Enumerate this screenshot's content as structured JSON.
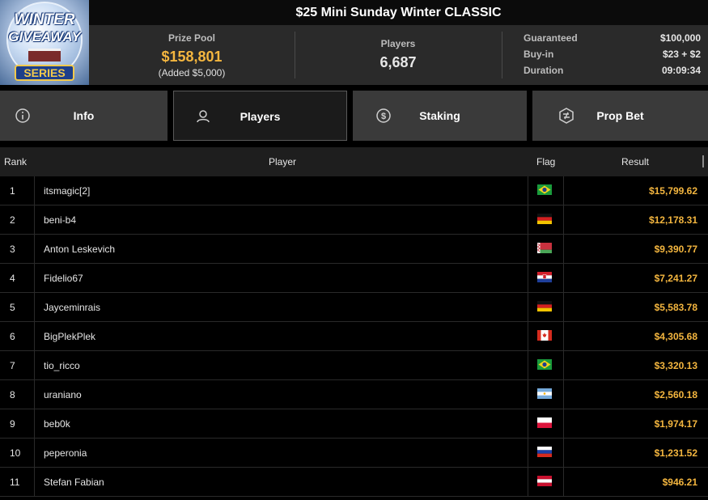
{
  "logo": {
    "line1": "WINTER",
    "line2": "GIVEAWAY",
    "line3": "SERIES"
  },
  "header": {
    "title": "$25 Mini Sunday Winter CLASSIC"
  },
  "stats": {
    "prize_pool_label": "Prize Pool",
    "prize_pool_value": "$158,801",
    "prize_pool_added": "(Added $5,000)",
    "players_label": "Players",
    "players_value": "6,687",
    "details": [
      {
        "label": "Guaranteed",
        "value": "$100,000"
      },
      {
        "label": "Buy-in",
        "value": "$23 + $2"
      },
      {
        "label": "Duration",
        "value": "09:09:34"
      }
    ]
  },
  "tabs": [
    {
      "label": "Info",
      "icon": "info-icon",
      "active": false
    },
    {
      "label": "Players",
      "icon": "user-icon",
      "active": true
    },
    {
      "label": "Staking",
      "icon": "staking-coin-icon",
      "active": false
    },
    {
      "label": "Prop Bet",
      "icon": "prop-bet-icon",
      "active": false
    }
  ],
  "table": {
    "headers": {
      "rank": "Rank",
      "player": "Player",
      "flag": "Flag",
      "result": "Result"
    },
    "rows": [
      {
        "rank": "1",
        "player": "itsmagic[2]",
        "flag": "brazil-flag",
        "result": "$15,799.62"
      },
      {
        "rank": "2",
        "player": "beni-b4",
        "flag": "germany-flag",
        "result": "$12,178.31"
      },
      {
        "rank": "3",
        "player": "Anton Leskevich",
        "flag": "belarus-flag",
        "result": "$9,390.77"
      },
      {
        "rank": "4",
        "player": "Fidelio67",
        "flag": "croatia-flag",
        "result": "$7,241.27"
      },
      {
        "rank": "5",
        "player": "Jayceminrais",
        "flag": "germany-flag",
        "result": "$5,583.78"
      },
      {
        "rank": "6",
        "player": "BigPlekPlek",
        "flag": "canada-flag",
        "result": "$4,305.68"
      },
      {
        "rank": "7",
        "player": "tio_ricco",
        "flag": "brazil-flag",
        "result": "$3,320.13"
      },
      {
        "rank": "8",
        "player": "uraniano",
        "flag": "argentina-flag",
        "result": "$2,560.18"
      },
      {
        "rank": "9",
        "player": "beb0k",
        "flag": "poland-flag",
        "result": "$1,974.17"
      },
      {
        "rank": "10",
        "player": "peperonia",
        "flag": "russia-flag",
        "result": "$1,231.52"
      },
      {
        "rank": "11",
        "player": "Stefan Fabian",
        "flag": "austria-flag",
        "result": "$946.21"
      }
    ]
  },
  "colors": {
    "accent_gold": "#f4b63f",
    "panel": "#2a2a2a",
    "tab": "#3a3a3a"
  }
}
